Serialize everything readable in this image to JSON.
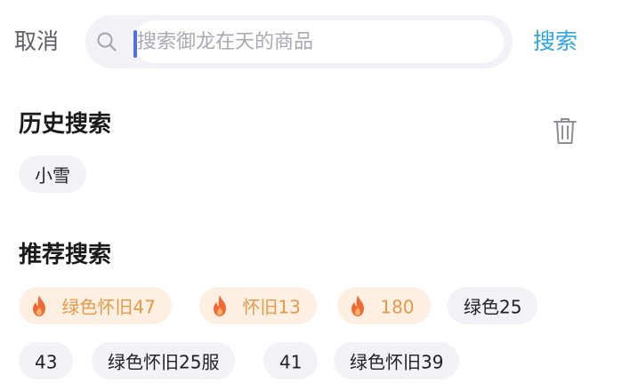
{
  "header": {
    "cancel_label": "取消",
    "search_placeholder": "搜索御龙在天的商品",
    "search_value": "",
    "search_label": "搜索"
  },
  "history": {
    "title": "历史搜索",
    "items": [
      "小雪"
    ]
  },
  "recommend": {
    "title": "推荐搜索",
    "items": [
      {
        "label": "绿色怀旧47",
        "hot": true
      },
      {
        "label": "怀旧13",
        "hot": true
      },
      {
        "label": "180",
        "hot": true
      },
      {
        "label": "绿色25",
        "hot": false
      },
      {
        "label": "43",
        "hot": false
      },
      {
        "label": "绿色怀旧25服",
        "hot": false
      },
      {
        "label": "41",
        "hot": false
      },
      {
        "label": "绿色怀旧39",
        "hot": false
      }
    ]
  },
  "icons": {
    "search": "search-icon",
    "trash": "trash-icon",
    "hot": "flame-icon"
  },
  "colors": {
    "accent": "#2fa6e6",
    "caret": "#4f6fe6",
    "hot_chip_bg": "#fdf0e3",
    "hot_chip_text": "#e59a4a",
    "flame": "#f06a35",
    "chip_bg": "#f2f2f7"
  }
}
